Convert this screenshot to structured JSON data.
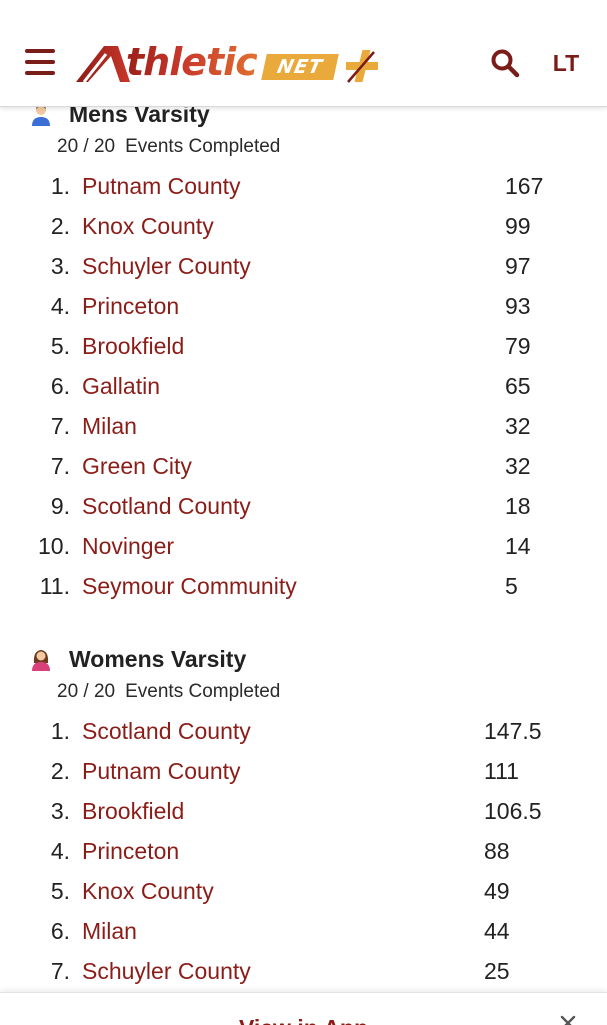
{
  "header": {
    "logo_text": "thletic",
    "logo_net": "NET",
    "lang_label": "LT",
    "icons": {
      "menu": "hamburger-menu-icon",
      "search": "search-icon",
      "plus": "plus-icon"
    },
    "brand_colors": {
      "primary": "#7a1c17",
      "gold": "#e9a93b",
      "link": "#8b1d18"
    }
  },
  "mens": {
    "title": "Mens Varsity",
    "completed": "20 / 20",
    "completed_label": "Events Completed",
    "icon": "male-athlete-icon",
    "teams": [
      {
        "rank": "1.",
        "name": "Putnam County",
        "score": "167"
      },
      {
        "rank": "2.",
        "name": "Knox County",
        "score": "99"
      },
      {
        "rank": "3.",
        "name": "Schuyler County",
        "score": "97"
      },
      {
        "rank": "4.",
        "name": "Princeton",
        "score": "93"
      },
      {
        "rank": "5.",
        "name": "Brookfield",
        "score": "79"
      },
      {
        "rank": "6.",
        "name": "Gallatin",
        "score": "65"
      },
      {
        "rank": "7.",
        "name": "Milan",
        "score": "32"
      },
      {
        "rank": "7.",
        "name": "Green City",
        "score": "32"
      },
      {
        "rank": "9.",
        "name": "Scotland County",
        "score": "18"
      },
      {
        "rank": "10.",
        "name": "Novinger",
        "score": "14"
      },
      {
        "rank": "11.",
        "name": "Seymour Community",
        "score": "5"
      }
    ]
  },
  "womens": {
    "title": "Womens Varsity",
    "completed": "20 / 20",
    "completed_label": "Events Completed",
    "icon": "female-athlete-icon",
    "teams": [
      {
        "rank": "1.",
        "name": "Scotland County",
        "score": "147.5"
      },
      {
        "rank": "2.",
        "name": "Putnam County",
        "score": "111"
      },
      {
        "rank": "3.",
        "name": "Brookfield",
        "score": "106.5"
      },
      {
        "rank": "4.",
        "name": "Princeton",
        "score": "88"
      },
      {
        "rank": "5.",
        "name": "Knox County",
        "score": "49"
      },
      {
        "rank": "6.",
        "name": "Milan",
        "score": "44"
      },
      {
        "rank": "7.",
        "name": "Schuyler County",
        "score": "25"
      }
    ]
  },
  "app_banner": {
    "link_label": "View in App",
    "close_icon": "close-icon"
  }
}
